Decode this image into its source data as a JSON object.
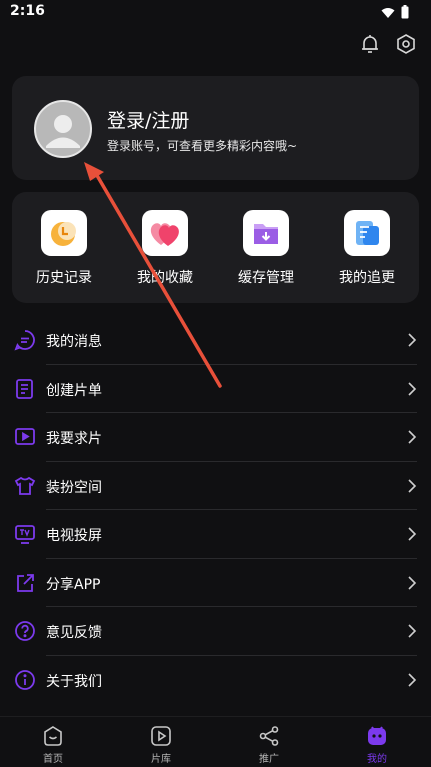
{
  "status_bar": {
    "time": "2:16"
  },
  "header": {
    "icons": [
      "bell-icon",
      "settings-icon"
    ]
  },
  "profile": {
    "title": "登录/注册",
    "subtitle": "登录账号，可查看更多精彩内容哦~"
  },
  "quick_actions": [
    {
      "label": "历史记录",
      "icon": "history-icon"
    },
    {
      "label": "我的收藏",
      "icon": "heart-icon"
    },
    {
      "label": "缓存管理",
      "icon": "download-folder-icon"
    },
    {
      "label": "我的追更",
      "icon": "document-icon"
    }
  ],
  "menu": [
    {
      "label": "我的消息",
      "icon": "message-icon"
    },
    {
      "label": "创建片单",
      "icon": "playlist-icon"
    },
    {
      "label": "我要求片",
      "icon": "video-request-icon"
    },
    {
      "label": "装扮空间",
      "icon": "shirt-icon"
    },
    {
      "label": "电视投屏",
      "icon": "tv-icon"
    },
    {
      "label": "分享APP",
      "icon": "share-icon"
    },
    {
      "label": "意见反馈",
      "icon": "question-icon"
    },
    {
      "label": "关于我们",
      "icon": "info-icon"
    }
  ],
  "bottom_nav": [
    {
      "label": "首页",
      "icon": "home-icon"
    },
    {
      "label": "片库",
      "icon": "library-icon"
    },
    {
      "label": "推广",
      "icon": "promote-icon"
    },
    {
      "label": "我的",
      "icon": "mine-icon",
      "active": true
    }
  ],
  "colors": {
    "accent": "#7c3aed",
    "background": "#101012",
    "card": "#1d1d20",
    "annotation_arrow": "#e8503a"
  }
}
